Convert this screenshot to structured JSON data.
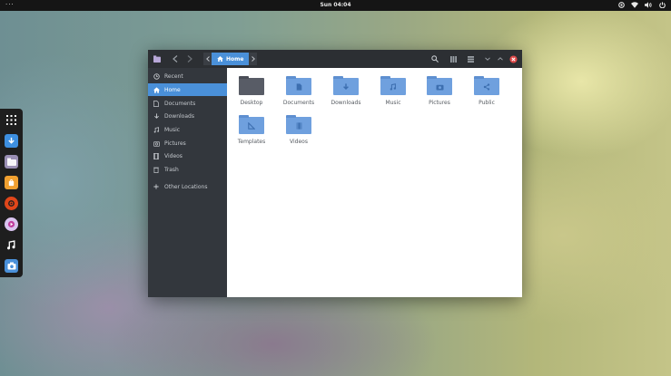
{
  "topbar": {
    "activities": "···",
    "clock": "Sun 04:04",
    "tray": [
      "network-icon",
      "wifi-icon",
      "volume-icon",
      "power-icon"
    ]
  },
  "dock": {
    "items": [
      "app-grid-icon",
      "download-manager-icon",
      "files-icon",
      "software-center-icon",
      "settings-icon",
      "video-player-icon",
      "music-icon",
      "screenshot-icon"
    ]
  },
  "window": {
    "pathbar": {
      "home_label": "Home"
    },
    "header_buttons": [
      "search-icon",
      "list-view-icon",
      "grid-view-icon",
      "minimize-icon",
      "maximize-icon",
      "close-icon"
    ],
    "colors": {
      "accent": "#4a90d9",
      "close": "#e04b4b",
      "folder": "#6fa0de"
    }
  },
  "sidebar": {
    "items": [
      {
        "label": "Recent",
        "icon": "clock-icon"
      },
      {
        "label": "Home",
        "icon": "home-icon",
        "active": true
      },
      {
        "label": "Documents",
        "icon": "document-icon"
      },
      {
        "label": "Downloads",
        "icon": "download-icon"
      },
      {
        "label": "Music",
        "icon": "music-note-icon"
      },
      {
        "label": "Pictures",
        "icon": "camera-icon"
      },
      {
        "label": "Videos",
        "icon": "film-icon"
      },
      {
        "label": "Trash",
        "icon": "trash-icon"
      }
    ],
    "other_locations": "Other Locations"
  },
  "files": [
    {
      "label": "Desktop",
      "icon": "desktop-folder-icon"
    },
    {
      "label": "Documents",
      "icon": "documents-folder-icon"
    },
    {
      "label": "Downloads",
      "icon": "downloads-folder-icon"
    },
    {
      "label": "Music",
      "icon": "music-folder-icon"
    },
    {
      "label": "Pictures",
      "icon": "pictures-folder-icon"
    },
    {
      "label": "Public",
      "icon": "public-folder-icon"
    },
    {
      "label": "Templates",
      "icon": "templates-folder-icon"
    },
    {
      "label": "Videos",
      "icon": "videos-folder-icon"
    }
  ]
}
